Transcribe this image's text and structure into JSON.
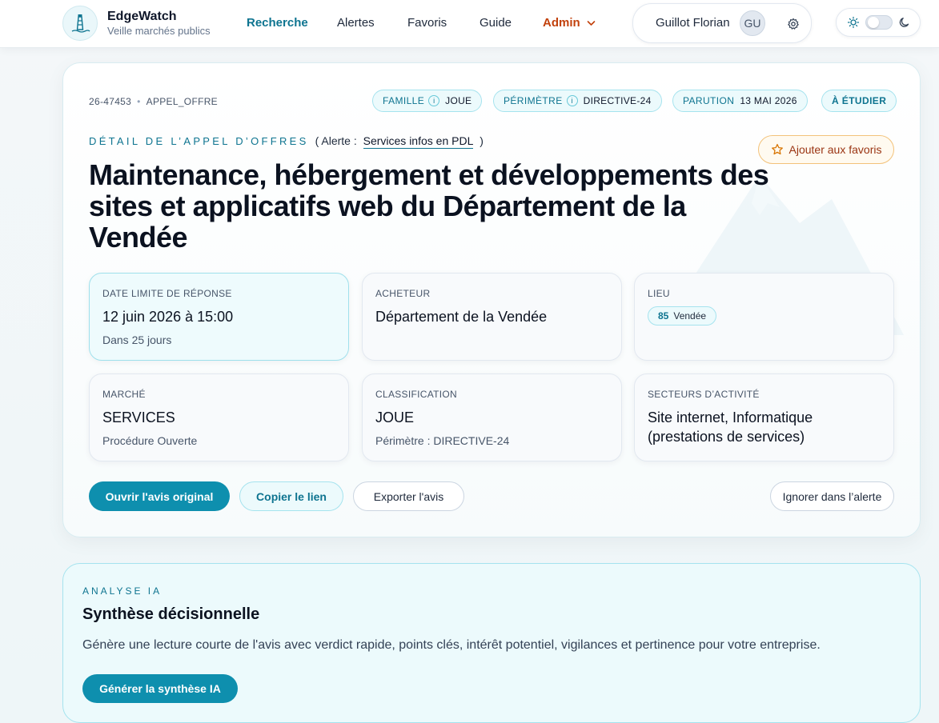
{
  "brand": {
    "name": "EdgeWatch",
    "tagline": "Veille marchés publics",
    "logo_icon": "lighthouse-icon"
  },
  "nav": {
    "items": [
      "Recherche",
      "Alertes",
      "Favoris",
      "Guide"
    ],
    "active": "Recherche",
    "admin_label": "Admin"
  },
  "user": {
    "name": "Guillot Florian",
    "initials": "GU"
  },
  "theme": {
    "mode": "light"
  },
  "notice": {
    "ref": "26-47453",
    "type": "APPEL_OFFRE",
    "chips": [
      {
        "key": "FAMILLE",
        "value": "JOUE"
      },
      {
        "key": "PÉRIMÈTRE",
        "value": "DIRECTIVE-24"
      },
      {
        "key": "PARUTION",
        "value": "13 MAI 2026"
      }
    ],
    "status": "À ÉTUDIER",
    "eyebrow": "DÉTAIL DE L’APPEL D’OFFRES",
    "alert_prefix": "( Alerte :",
    "alert_name": "Services infos en PDL",
    "alert_suffix": ")",
    "favorite_label": "Ajouter aux favoris",
    "title": "Maintenance, hébergement et développements des sites et applicatifs web du Département de la Vendée"
  },
  "info_cards": {
    "deadline": {
      "label": "DATE LIMITE DE RÉPONSE",
      "value": "12 juin 2026 à 15:00",
      "sub": "Dans 25 jours"
    },
    "buyer": {
      "label": "ACHETEUR",
      "value": "Département de la Vendée"
    },
    "location": {
      "label": "LIEU",
      "code": "85",
      "name": "Vendée"
    },
    "market": {
      "label": "MARCHÉ",
      "value": "SERVICES",
      "sub": "Procédure Ouverte"
    },
    "classification": {
      "label": "CLASSIFICATION",
      "value": "JOUE",
      "sub": "Périmètre : DIRECTIVE-24"
    },
    "sectors": {
      "label": "SECTEURS D’ACTIVITÉ",
      "value": "Site internet, Informatique (prestations de services)"
    }
  },
  "actions": {
    "open_original": "Ouvrir l'avis original",
    "copy_link": "Copier le lien",
    "export": "Exporter l'avis",
    "ignore": "Ignorer dans l’alerte"
  },
  "ai": {
    "eyebrow": "ANALYSE IA",
    "title": "Synthèse décisionnelle",
    "description": "Génère une lecture courte de l'avis avec verdict rapide, points clés, intérêt potentiel, vigilances et pertinence pour votre entreprise.",
    "button": "Générer la synthèse IA"
  },
  "colors": {
    "accent": "#0e8fae",
    "accent_dark": "#0e7490",
    "admin": "#c2410c",
    "favorite": "#d97706"
  }
}
